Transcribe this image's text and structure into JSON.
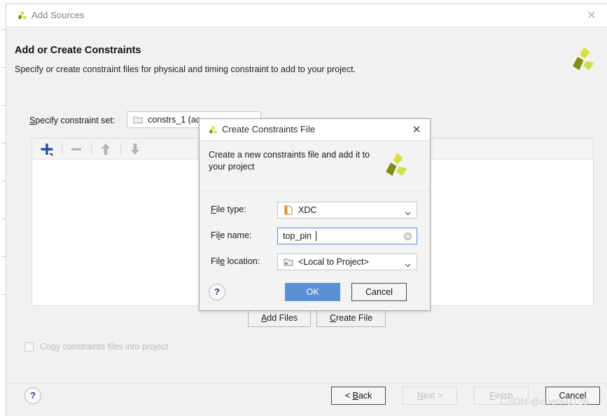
{
  "window": {
    "title": "Add Sources",
    "close_icon": "close-icon",
    "logo_icon": "vivado-logo-icon"
  },
  "wizard": {
    "heading": "Add or Create Constraints",
    "subtitle": "Specify or create constraint files for physical and timing constraint to add to your project.",
    "logo_icon": "vivado-logo-icon",
    "constraint_set": {
      "label_pre": "S",
      "label_post": "pecify constraint set:",
      "folder_icon": "folder-icon",
      "value": "constrs_1 (ac"
    },
    "list_toolbar": {
      "add_icon": "plus-icon",
      "remove_icon": "minus-icon",
      "move_up_icon": "arrow-up-icon",
      "move_down_icon": "arrow-down-icon"
    },
    "add_files_pre": "A",
    "add_files_post": "dd Files",
    "create_file_pre": "C",
    "create_file_post": "reate File",
    "copy_checkbox": {
      "label_a": "Co",
      "label_key": "p",
      "label_b": "y constraints files into project",
      "checked": false,
      "enabled": false
    }
  },
  "footer": {
    "help_label": "?",
    "back_pre": "< ",
    "back_key": "B",
    "back_post": "ack",
    "next_key": "N",
    "next_post": "ext >",
    "finish_key": "F",
    "finish_post": "inish",
    "cancel_label": "Cancel"
  },
  "modal": {
    "title": "Create Constraints File",
    "logo_icon": "vivado-logo-icon",
    "close_icon": "close-icon",
    "banner_text": "Create a new constraints file and add it to your project",
    "fields": {
      "file_type": {
        "label_key": "F",
        "label_post": "ile type:",
        "icon": "xdc-file-icon",
        "value": "XDC",
        "chevron_icon": "chevron-down-icon"
      },
      "file_name": {
        "label_pre": "Fi",
        "label_key": "l",
        "label_post": "e name:",
        "value": "top_pin",
        "clear_icon": "clear-circle-icon",
        "focused": true
      },
      "file_location": {
        "label_pre": "Fil",
        "label_key": "e",
        "label_post": " location:",
        "icon": "folder-project-icon",
        "value": "<Local to Project>",
        "chevron_icon": "chevron-down-icon"
      }
    },
    "help_label": "?",
    "ok_label": "OK",
    "cancel_label": "Cancel"
  },
  "watermark": "CSDN @chenyu128",
  "colors": {
    "accent_blue": "#5b8fd4",
    "logo_light": "#d6e03a",
    "logo_dark": "#7f8c15",
    "plus_blue": "#2a4fa2"
  }
}
